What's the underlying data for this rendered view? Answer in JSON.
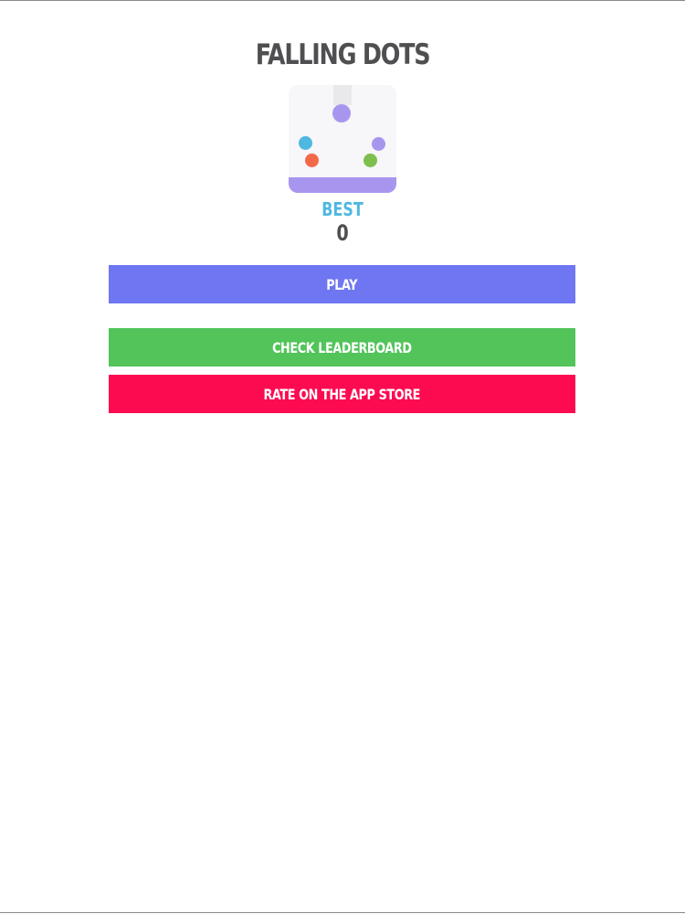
{
  "screen": {
    "title": "FALLING DOTS",
    "best_label": "BEST",
    "best_score": "0",
    "colors": {
      "title": "#4f4f52",
      "best_label": "#4fb8e0",
      "best_value": "#4f4f52",
      "play": "#6f76f2",
      "leaderboard": "#52c45a",
      "rate": "#fc0b51",
      "logo_background": "#f7f6f8",
      "logo_floor": "#a896ee"
    }
  },
  "logo": {
    "dots": [
      {
        "name": "falling-purple-dot",
        "color": "#a896ee"
      },
      {
        "name": "blue-dot",
        "color": "#4fb8e0"
      },
      {
        "name": "orange-dot",
        "color": "#f2694a"
      },
      {
        "name": "small-purple-dot",
        "color": "#a896ee"
      },
      {
        "name": "green-dot",
        "color": "#7cbf4c"
      }
    ]
  },
  "buttons": {
    "play": "PLAY",
    "leaderboard": "CHECK LEADERBOARD",
    "rate": "RATE ON THE APP STORE"
  }
}
